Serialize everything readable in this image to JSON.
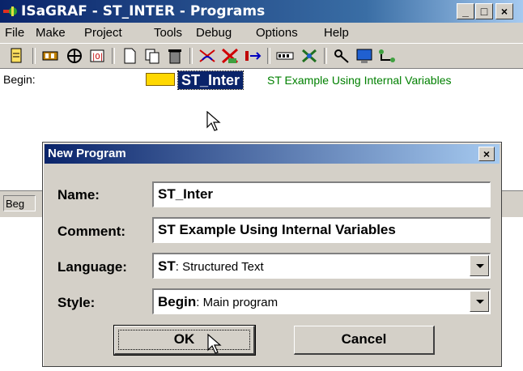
{
  "window": {
    "title": "ISaGRAF - ST_INTER - Programs",
    "controls": [
      "_",
      "□",
      "×"
    ]
  },
  "menu": [
    "File",
    "Make",
    "Project",
    "Tools",
    "Debug",
    "Options",
    "Help"
  ],
  "toolbar_icons": [
    "program-icon",
    "make-icon",
    "link-icon",
    "variables-icon",
    "new-icon",
    "copy-icon",
    "delete-icon",
    "compile-icon",
    "verify-icon",
    "target-icon",
    "io-icon",
    "debug-icon",
    "spy-icon",
    "monitor-icon",
    "network-icon"
  ],
  "list": {
    "section": "Begin:",
    "program_name": "ST_Inter",
    "program_comment": "ST Example Using Internal Variables"
  },
  "status": {
    "text": "Beg"
  },
  "dialog": {
    "title": "New Program",
    "close": "×",
    "name_label": "Name:",
    "name_value": "ST_Inter",
    "comment_label": "Comment:",
    "comment_value": "ST Example Using Internal Variables",
    "language_label": "Language:",
    "language_code": "ST",
    "language_desc": ": Structured Text",
    "style_label": "Style:",
    "style_code": "Begin",
    "style_desc": ": Main program",
    "ok_label": "OK",
    "cancel_label": "Cancel"
  },
  "colors": {
    "titlebar": "#0a246a",
    "comment_green": "#008000",
    "face": "#d4d0c8"
  }
}
